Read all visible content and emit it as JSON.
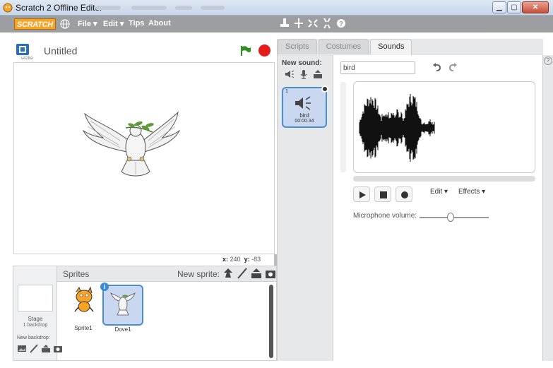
{
  "window": {
    "title": "Scratch 2 Offline Editor"
  },
  "menubar": {
    "logo": "SCRATCH",
    "items": [
      {
        "label": "File ▾"
      },
      {
        "label": "Edit ▾"
      },
      {
        "label": "Tips"
      },
      {
        "label": "About"
      }
    ]
  },
  "stage": {
    "project_title": "Untitled",
    "version": "v428a",
    "coords": {
      "x_label": "x:",
      "x": "240",
      "y_label": "y:",
      "y": "-83"
    }
  },
  "sprites_panel": {
    "title": "Sprites",
    "new_sprite": "New sprite:",
    "stage_label": "Stage",
    "backdrop_count": "1 backdrop",
    "new_backdrop": "New backdrop:",
    "sprites": [
      {
        "name": "Sprite1"
      },
      {
        "name": "Dove1"
      }
    ]
  },
  "editor": {
    "tabs": [
      {
        "label": "Scripts"
      },
      {
        "label": "Costumes"
      },
      {
        "label": "Sounds"
      }
    ],
    "active_tab": "Sounds",
    "new_sound": "New sound:",
    "sound": {
      "index": "1",
      "name": "bird",
      "duration": "00:00.34"
    },
    "sound_name_value": "bird",
    "edit_menu": "Edit ▾",
    "effects_menu": "Effects ▾",
    "mic_label": "Microphone volume:",
    "mic_level": 0.45
  },
  "colors": {
    "accent": "#4a8fd6",
    "menubar": "#9c9ea2",
    "stop": "#e31b1b",
    "flag": "#2f8f1f",
    "logo": "#f7a325"
  }
}
